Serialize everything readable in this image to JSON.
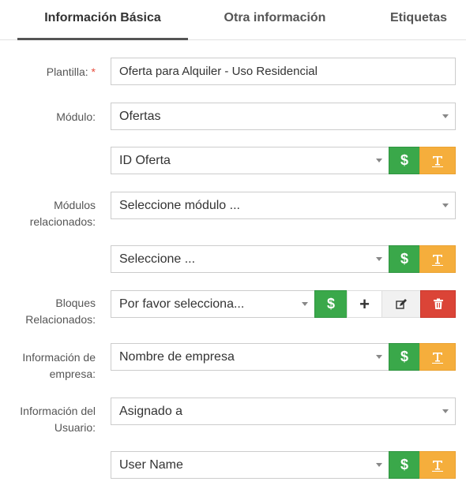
{
  "tabs": [
    {
      "label": "Información Básica"
    },
    {
      "label": "Otra información"
    },
    {
      "label": "Etiquetas"
    }
  ],
  "form": {
    "plantilla": {
      "label": "Plantilla:",
      "required_mark": "*",
      "value": "Oferta para Alquiler - Uso Residencial"
    },
    "modulo": {
      "label": "Módulo:",
      "value": "Ofertas"
    },
    "modulo_field": {
      "value": "ID Oferta"
    },
    "modulos_relacionados": {
      "label_line1": "Módulos",
      "label_line2": "relacionados:",
      "value": "Seleccione módulo ..."
    },
    "campo_relacionado": {
      "value": "Seleccione ..."
    },
    "bloques_relacionados": {
      "label_line1": "Bloques",
      "label_line2": "Relacionados:",
      "value": "Por favor selecciona..."
    },
    "info_empresa": {
      "label_line1": "Información de",
      "label_line2": "empresa:",
      "value": "Nombre de empresa"
    },
    "info_usuario": {
      "label_line1": "Información del",
      "label_line2": "Usuario:",
      "value": "Asignado a"
    },
    "usuario_field": {
      "value": "User Name"
    }
  },
  "buttons": {
    "dollar": "$",
    "plus": "+"
  },
  "icons": {
    "dollar": "dollar-icon",
    "text": "text-format-icon",
    "plus": "plus-icon",
    "edit": "edit-icon",
    "delete": "trash-icon",
    "caret": "chevron-down-icon"
  },
  "colors": {
    "green": "#3aa84a",
    "orange": "#f5ae3c",
    "red": "#db4437",
    "required": "#e74c3c"
  }
}
